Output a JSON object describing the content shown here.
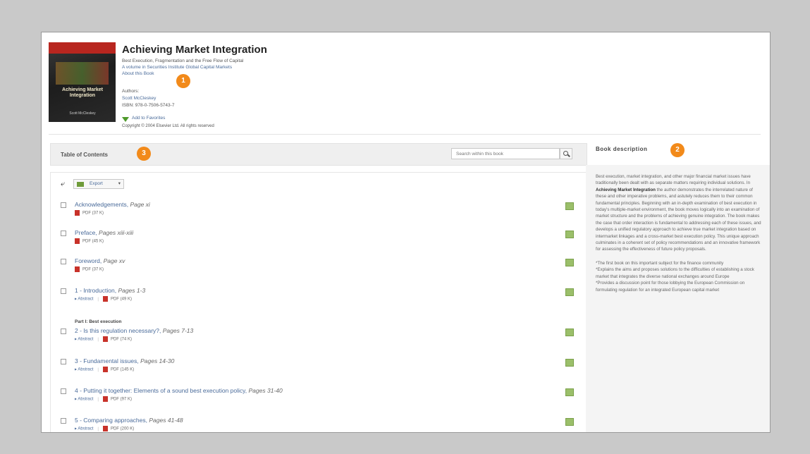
{
  "book": {
    "title": "Achieving Market Integration",
    "subtitle": "Best Execution, Fragmentation and the Free Flow of Capital",
    "series": "A volume in Securities Institute Global Capital Markets",
    "about_link": "About this Book",
    "authors_label": "Authors:",
    "author": "Scott McCleskey",
    "isbn": "ISBN: 978-0-7506-5743-7",
    "favorites_link": "Add to Favorites",
    "copyright": "Copyright © 2004 Elsevier Ltd. All rights reserved",
    "cover_title": "Achieving Market Integration",
    "cover_author": "Scott McCleskey"
  },
  "badges": {
    "one": "1",
    "two": "2",
    "three": "3"
  },
  "toc": {
    "header": "Table of Contents",
    "search_placeholder": "Search within this book",
    "export_label": "Export",
    "abstract_label": "Abstract",
    "part_label": "Part I: Best execution",
    "entries": [
      {
        "title": "Acknowledgements,",
        "pages": "Page xi",
        "pdf": "PDF (37 K)",
        "abstract": false
      },
      {
        "title": "Preface,",
        "pages": "Pages xiii-xiii",
        "pdf": "PDF (45 K)",
        "abstract": false
      },
      {
        "title": "Foreword,",
        "pages": "Page xv",
        "pdf": "PDF (37 K)",
        "abstract": false
      },
      {
        "title": "1 - Introduction,",
        "pages": "Pages 1-3",
        "pdf": "PDF (49 K)",
        "abstract": true
      },
      {
        "title": "2 - Is this regulation necessary?,",
        "pages": "Pages 7-13",
        "pdf": "PDF (74 K)",
        "abstract": true
      },
      {
        "title": "3 - Fundamental issues,",
        "pages": "Pages 14-30",
        "pdf": "PDF (145 K)",
        "abstract": true
      },
      {
        "title": "4 - Putting it together: Elements of a sound best execution policy,",
        "pages": "Pages 31-40",
        "pdf": "PDF (97 K)",
        "abstract": true
      },
      {
        "title": "5 - Comparing approaches,",
        "pages": "Pages 41-48",
        "pdf": "PDF (200 K)",
        "abstract": true
      }
    ]
  },
  "description": {
    "header": "Book description",
    "p1_before": "Best execution, market integration, and other major financial market issues have traditionally been dealt with as separate matters requiring individual solutions. In ",
    "p1_bold": "Achieving Market Integration",
    "p1_after": " the author demonstrates the interrelated nature of these and other imperative problems, and astutely reduces them to their common fundamental principles. Beginning with an in-depth examination of best execution in today's multiple-market environment, the book moves logically into an examination of market structure and the problems of achieving genuine integration. The book makes the case that order interaction is fundamental to addressing each of these issues, and develops a unified regulatory approach to achieve true market integration based on intermarket linkages and a cross-market best execution policy. This unique approach culminates in a coherent set of policy recommendations and an innovative framework for assessing the effectiveness of future policy proposals.",
    "b1": "*The first book on this important subject for the finance community",
    "b2": "*Explains the aims and proposes solutions to the difficulties of establishing a stock market that integrates the diverse national exchanges around Europe",
    "b3": "*Provides a discussion point for those lobbying the European Commission on formulating regulation for an integrated European capital market"
  },
  "colors": {
    "badge": "#f28a1a",
    "link": "#4a6b9a",
    "pdf_red": "#c8322a",
    "favorite_green": "#4e9a2b"
  }
}
